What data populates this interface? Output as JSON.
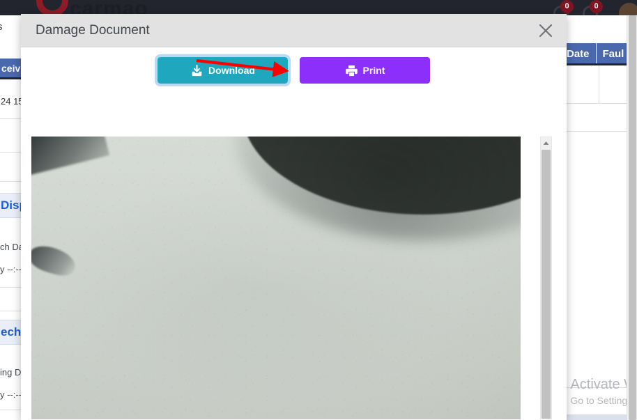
{
  "background_app": {
    "brand_text": "carmao",
    "notifications": [
      {
        "icon": "bell-icon",
        "count": "0"
      },
      {
        "icon": "bell-icon",
        "count": "0"
      }
    ],
    "left_panel": {
      "tab_fragment": "s",
      "table_header_fragment": "ceiv",
      "cell_fragment": "24 15",
      "field_label_1": "Disp",
      "field_sub_1": "ch Da",
      "field_value_1": "y --:--",
      "field_label_2": "ech",
      "field_sub_2": "ing D",
      "field_value_2": "y --:--"
    },
    "right_panel": {
      "table_headers": [
        "Date",
        "Faul"
      ]
    },
    "watermark": {
      "title": "Activate W",
      "subtitle": "Go to Settings"
    }
  },
  "modal": {
    "title": "Damage Document",
    "close_label": "×",
    "buttons": {
      "download": {
        "label": "Download",
        "icon": "download-icon",
        "color": "#1fa7bd"
      },
      "print": {
        "label": "Print",
        "icon": "printer-icon",
        "color": "#8c2ffb"
      }
    },
    "viewer": {
      "alt": "Damage photo of pale grey vehicle panel with dark wheel arch",
      "scroll_up_icon": "chevron-up-icon"
    }
  },
  "annotation": {
    "type": "arrow",
    "color": "#ff0000",
    "points_to": "download-button"
  }
}
